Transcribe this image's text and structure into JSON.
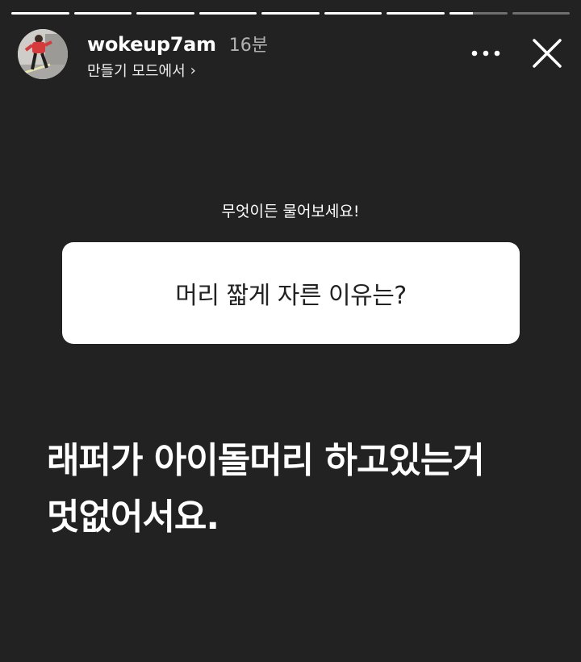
{
  "story": {
    "segments": [
      {
        "progress": 1
      },
      {
        "progress": 1
      },
      {
        "progress": 1
      },
      {
        "progress": 1
      },
      {
        "progress": 1
      },
      {
        "progress": 1
      },
      {
        "progress": 1
      },
      {
        "progress": 0.4
      },
      {
        "progress": 0
      }
    ]
  },
  "header": {
    "username": "wokeup7am",
    "time": "16분",
    "subtitle": "만들기 모드에서",
    "subtitle_chevron": "›",
    "more_icon": "more-dots-icon",
    "close_icon": "close-icon"
  },
  "prompt": "무엇이든 물어보세요!",
  "question": "머리 짧게 자른 이유는?",
  "answer": {
    "line1": "래퍼가 아이돌머리 하고있는거",
    "line2": "멋없어서요."
  },
  "colors": {
    "background": "#222222",
    "card": "#ffffff",
    "text_on_card": "#222222"
  }
}
